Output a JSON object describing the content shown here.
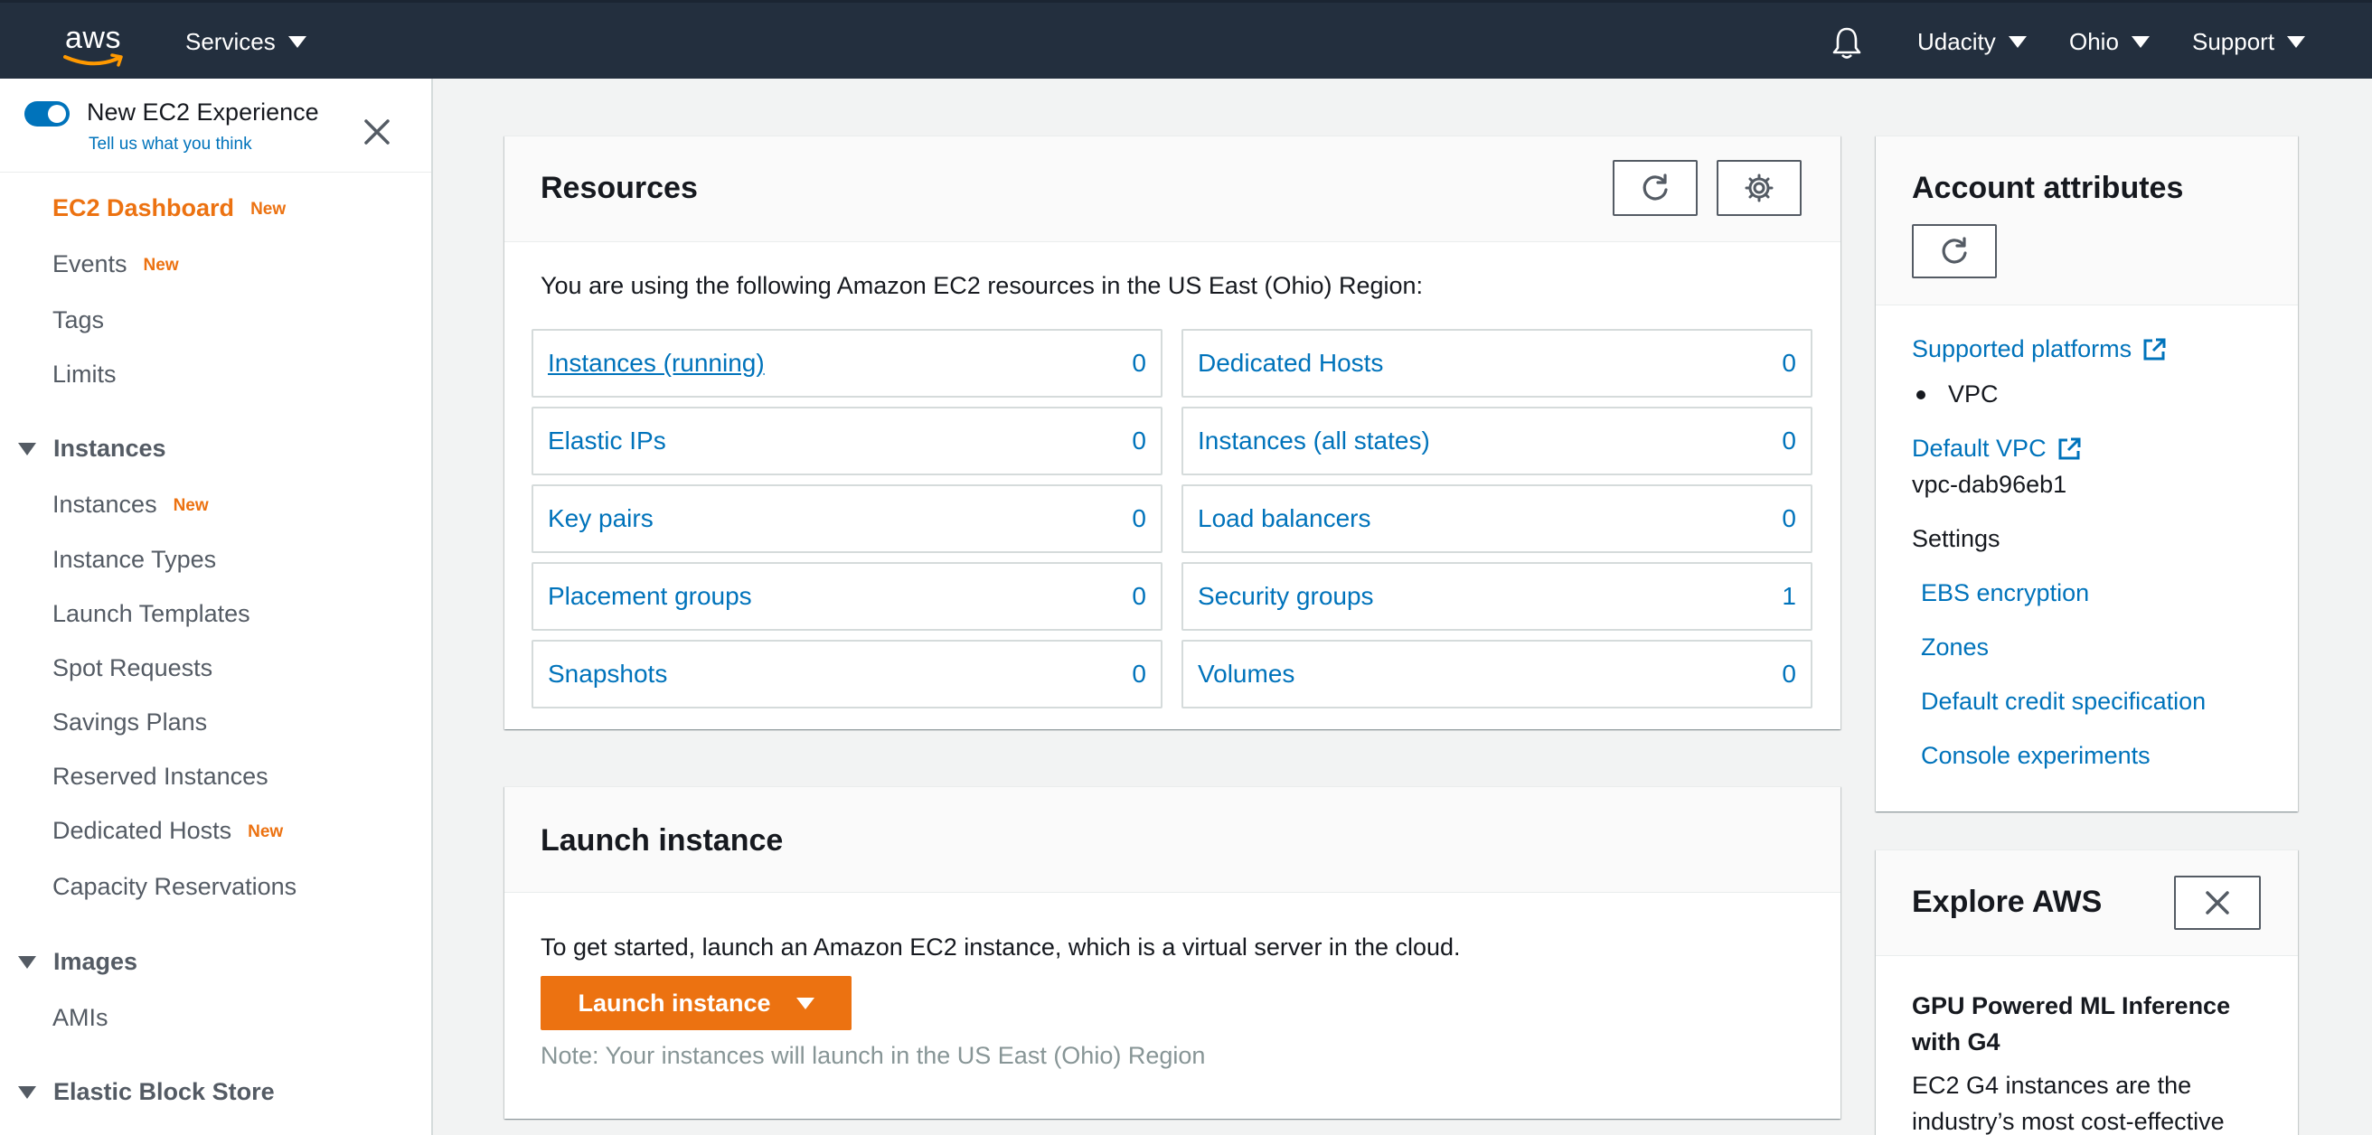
{
  "topnav": {
    "logo": "aws",
    "services": "Services",
    "account": "Udacity",
    "region": "Ohio",
    "support": "Support"
  },
  "sidebar": {
    "experience_title": "New EC2 Experience",
    "experience_link": "Tell us what you think",
    "new_badge": "New",
    "items": [
      {
        "label": "EC2 Dashboard"
      },
      {
        "label": "Events"
      },
      {
        "label": "Tags"
      },
      {
        "label": "Limits"
      },
      {
        "label": "Instances"
      },
      {
        "label": "Instance Types"
      },
      {
        "label": "Launch Templates"
      },
      {
        "label": "Spot Requests"
      },
      {
        "label": "Savings Plans"
      },
      {
        "label": "Reserved Instances"
      },
      {
        "label": "Dedicated Hosts"
      },
      {
        "label": "Capacity Reservations"
      },
      {
        "label": "AMIs"
      }
    ],
    "sections": [
      "Instances",
      "Images",
      "Elastic Block Store"
    ]
  },
  "resources": {
    "title": "Resources",
    "intro": "You are using the following Amazon EC2 resources in the US East (Ohio) Region:",
    "cells": [
      {
        "label": "Instances (running)",
        "value": "0"
      },
      {
        "label": "Dedicated Hosts",
        "value": "0"
      },
      {
        "label": "Elastic IPs",
        "value": "0"
      },
      {
        "label": "Instances (all states)",
        "value": "0"
      },
      {
        "label": "Key pairs",
        "value": "0"
      },
      {
        "label": "Load balancers",
        "value": "0"
      },
      {
        "label": "Placement groups",
        "value": "0"
      },
      {
        "label": "Security groups",
        "value": "1"
      },
      {
        "label": "Snapshots",
        "value": "0"
      },
      {
        "label": "Volumes",
        "value": "0"
      }
    ]
  },
  "launch": {
    "title": "Launch instance",
    "text": "To get started, launch an Amazon EC2 instance, which is a virtual server in the cloud.",
    "button": "Launch instance",
    "note": "Note: Your instances will launch in the US East (Ohio) Region"
  },
  "account": {
    "title": "Account attributes",
    "supported_platforms": "Supported platforms",
    "platform_vpc": "VPC",
    "default_vpc": "Default VPC",
    "vpc_id": "vpc-dab96eb1",
    "settings": "Settings",
    "links": [
      "EBS encryption",
      "Zones",
      "Default credit specification",
      "Console experiments"
    ]
  },
  "explore": {
    "title": "Explore AWS",
    "subtitle": "GPU Powered ML Inference with G4",
    "body": "EC2 G4 instances are the industry’s most cost-effective"
  },
  "colors": {
    "nav_bg": "#232f3e",
    "link": "#0073bb",
    "accent_orange": "#ec7211"
  }
}
